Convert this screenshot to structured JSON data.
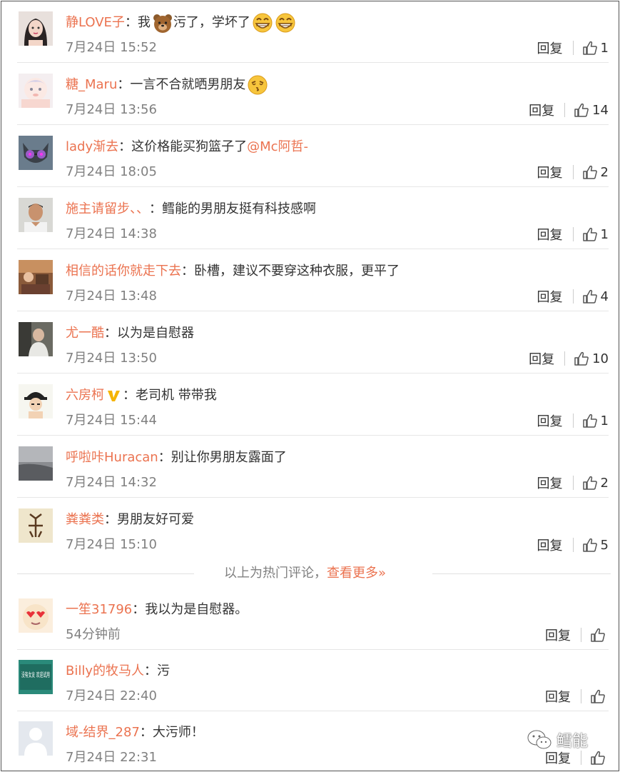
{
  "colors": {
    "username": "#eb7350",
    "text": "#333333",
    "time": "#808080",
    "divider": "#e6e6e6"
  },
  "comments": [
    {
      "username": "静LOVE子",
      "text": "：我",
      "text2": "污了，学坏了",
      "time": "7月24日 15:52",
      "reply": "回复",
      "likes": "1",
      "avatar": "girl-avatar",
      "emojis": [
        "bear-emoji",
        "grin-emoji",
        "grin-emoji"
      ]
    },
    {
      "username": "糖_Maru",
      "text": "：一言不合就晒男朋友",
      "time": "7月24日 13:56",
      "reply": "回复",
      "likes": "14",
      "avatar": "anime-avatar",
      "emojis": [
        "kiss-emoji"
      ]
    },
    {
      "username": "lady渐去",
      "text": "：这价格能买狗篮子了",
      "mention": "@Mc阿哲-",
      "time": "7月24日 18:05",
      "reply": "回复",
      "likes": "2",
      "avatar": "cat-avatar"
    },
    {
      "username": "施主请留步、、",
      "text": "：鳕能的男朋友挺有科技感啊",
      "time": "7月24日 14:38",
      "reply": "回复",
      "likes": "1",
      "avatar": "man-avatar"
    },
    {
      "username": "相信的话你就走下去",
      "text": "：卧槽，建议不要穿这种衣服，更平了",
      "time": "7月24日 13:48",
      "reply": "回复",
      "likes": "4",
      "avatar": "photo-avatar"
    },
    {
      "username": "尤一酷",
      "text": "：以为是自慰器",
      "time": "7月24日 13:50",
      "reply": "回复",
      "likes": "10",
      "avatar": "old-man-avatar"
    },
    {
      "username": "六房柯",
      "text": "：老司机 带带我",
      "time": "7月24日 15:44",
      "reply": "回复",
      "likes": "1",
      "avatar": "cartoon-avatar",
      "badge": "verified-v-icon"
    },
    {
      "username": "呼啦咔Huracan",
      "text": "：别让你男朋友露面了",
      "time": "7月24日 14:32",
      "reply": "回复",
      "likes": "2",
      "avatar": "landscape-avatar"
    },
    {
      "username": "粪粪类",
      "text": "：男朋友好可爱",
      "time": "7月24日 15:10",
      "reply": "回复",
      "likes": "5",
      "avatar": "glyph-avatar"
    },
    {
      "username": "一笙31796",
      "text": "：我以为是自慰器。",
      "time": "54分钟前",
      "reply": "回复",
      "likes": "",
      "avatar": "heart-eyes-avatar"
    },
    {
      "username": "Billy的牧马人",
      "text": "：污",
      "time": "7月24日 22:40",
      "reply": "回复",
      "likes": "",
      "avatar": "sign-avatar",
      "avatar_text": "没有女友 欢迎试用"
    },
    {
      "username": "域-结界_287",
      "text": "：大污师！",
      "time": "7月24日 22:31",
      "reply": "回复",
      "likes": "",
      "avatar": "default-avatar"
    }
  ],
  "hot_divider": {
    "label": "以上为热门评论，",
    "more": "查看更多»"
  },
  "watermark": {
    "text": "鳕能",
    "icon": "wechat-icon"
  }
}
